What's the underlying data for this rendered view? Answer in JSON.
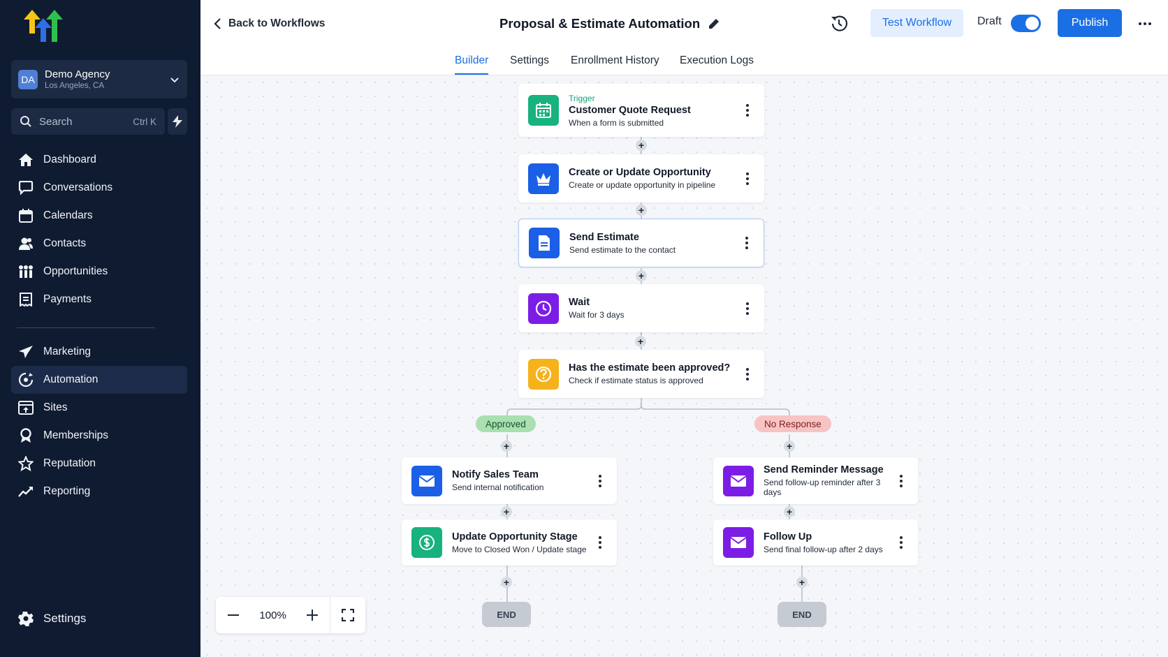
{
  "sidebar": {
    "agency": {
      "initials": "DA",
      "name": "Demo Agency",
      "location": "Los Angeles, CA"
    },
    "search": {
      "placeholder": "Search",
      "shortcut": "Ctrl K"
    },
    "nav_primary": [
      {
        "label": "Dashboard",
        "icon": "home-icon"
      },
      {
        "label": "Conversations",
        "icon": "chat-icon"
      },
      {
        "label": "Calendars",
        "icon": "calendar-icon"
      },
      {
        "label": "Contacts",
        "icon": "contacts-icon"
      },
      {
        "label": "Opportunities",
        "icon": "opportunities-icon"
      },
      {
        "label": "Payments",
        "icon": "payments-icon"
      }
    ],
    "nav_secondary": [
      {
        "label": "Marketing",
        "icon": "send-icon"
      },
      {
        "label": "Automation",
        "icon": "automation-icon",
        "active": true
      },
      {
        "label": "Sites",
        "icon": "sites-icon"
      },
      {
        "label": "Memberships",
        "icon": "membership-icon"
      },
      {
        "label": "Reputation",
        "icon": "star-icon"
      },
      {
        "label": "Reporting",
        "icon": "chart-icon"
      }
    ],
    "settings_label": "Settings"
  },
  "topbar": {
    "back_label": "Back to Workflows",
    "title": "Proposal & Estimate Automation",
    "test_label": "Test Workflow",
    "draft_label": "Draft",
    "publish_label": "Publish"
  },
  "tabs": [
    "Builder",
    "Settings",
    "Enrollment History",
    "Execution Logs"
  ],
  "workflow": {
    "trigger": {
      "kicker": "Trigger",
      "title": "Customer Quote Request",
      "subtitle": "When a form is submitted"
    },
    "step_opportunity": {
      "title": "Create or Update Opportunity",
      "subtitle": "Create or update opportunity in pipeline"
    },
    "step_estimate": {
      "title": "Send Estimate",
      "subtitle": "Send estimate to the contact"
    },
    "step_wait": {
      "title": "Wait",
      "subtitle": "Wait for 3 days"
    },
    "step_condition": {
      "title": "Has the estimate been approved?",
      "subtitle": "Check if estimate status is approved"
    },
    "branch_approved": "Approved",
    "branch_no_response": "No Response",
    "step_notify": {
      "title": "Notify Sales Team",
      "subtitle": "Send internal notification"
    },
    "step_update_stage": {
      "title": "Update Opportunity Stage",
      "subtitle": "Move to Closed Won / Update stage"
    },
    "step_reminder": {
      "title": "Send Reminder Message",
      "subtitle": "Send follow-up reminder after 3 days"
    },
    "step_followup": {
      "title": "Follow Up",
      "subtitle": "Send final follow-up after 2 days"
    },
    "end_label": "END",
    "add_symbol": "+"
  },
  "zoom": {
    "value": "100%"
  },
  "colors": {
    "sidebar_bg": "#0f1b30",
    "accent": "#1b6fe4",
    "trigger_green": "#16a37a",
    "blue_icon": "#1a5fe6",
    "purple_icon": "#7c1de6",
    "amber_icon": "#f5b21b",
    "teal_icon": "#18b27f"
  }
}
